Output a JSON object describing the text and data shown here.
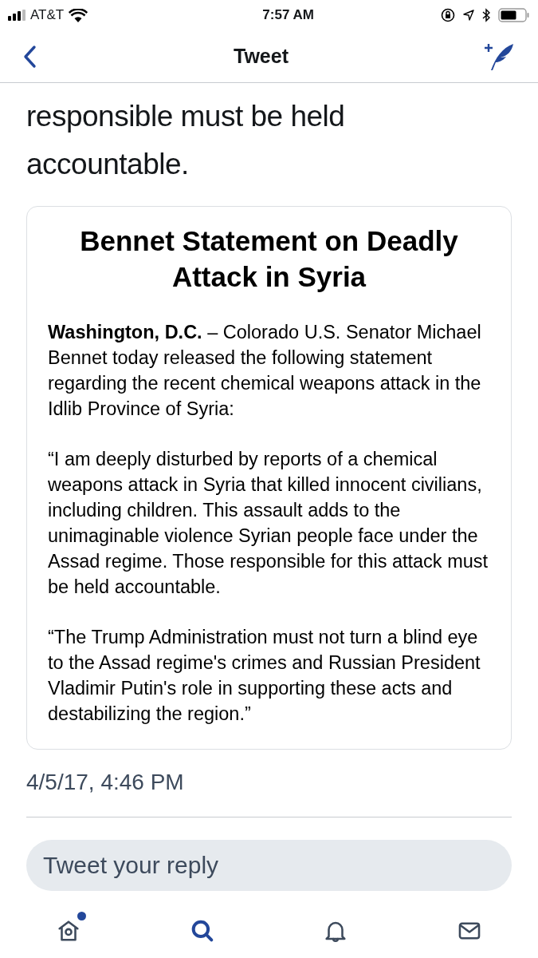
{
  "status_bar": {
    "carrier": "AT&T",
    "time": "7:57 AM"
  },
  "nav": {
    "title": "Tweet"
  },
  "tweet": {
    "text": "responsible must be held accountable.",
    "card": {
      "title": "Bennet Statement on Deadly Attack in Syria",
      "paragraphs": [
        "**Washington, D.C.** – Colorado U.S. Senator Michael Bennet today released the following statement regarding the recent chemical weapons attack in the Idlib Province of Syria:",
        "“I am deeply disturbed by reports of a chemical weapons attack in Syria that killed innocent civilians, including children. This assault adds to the unimaginable violence Syrian people face under the Assad regime. Those responsible for this attack must be held accountable.",
        "“The Trump Administration must not turn a blind eye to the Assad regime's crimes and Russian President Vladimir Putin's role in supporting these acts and destabilizing the region.”"
      ]
    },
    "timestamp": "4/5/17, 4:46 PM"
  },
  "reply": {
    "placeholder": "Tweet your reply"
  },
  "tab_bar": [
    {
      "kind": "home",
      "selected": false,
      "unread": true
    },
    {
      "kind": "search",
      "selected": true,
      "unread": false
    },
    {
      "kind": "notifications",
      "selected": false,
      "unread": false
    },
    {
      "kind": "messages",
      "selected": false,
      "unread": false
    }
  ]
}
